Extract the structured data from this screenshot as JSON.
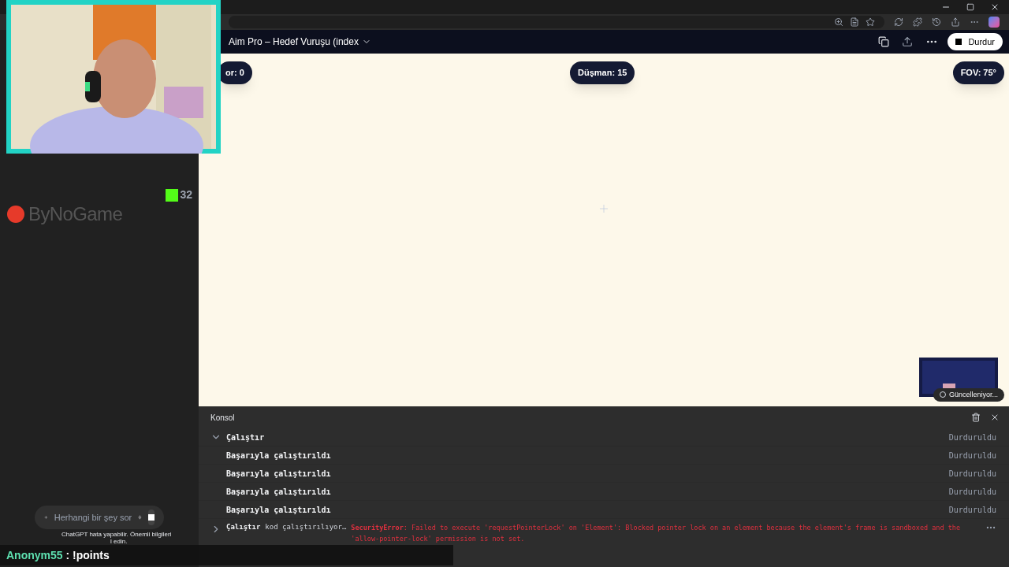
{
  "header": {
    "title": "Aim Pro – Hedef Vuruşu (index",
    "stop_button": "Durdur"
  },
  "hud": {
    "left": "or: 0",
    "center": "Düşman: 15",
    "right": "FOV: 75°"
  },
  "minimap": {
    "status": "Güncelleniyor..."
  },
  "sidebar": {
    "logo": "ByNoGame",
    "viewer_count": "32",
    "input_placeholder": "Herhangi bir şey sor",
    "footnote": "ChatGPT hata yapabilir. Önemli bilgileri",
    "footnote_tail": "l edin."
  },
  "chat_overlay": {
    "user": "Anonym55",
    "message": " : !points"
  },
  "console": {
    "title": "Konsol",
    "rows": [
      {
        "kind": "group",
        "expanded": true,
        "label": "Çalıştır",
        "status": "Durduruldu"
      },
      {
        "kind": "message",
        "label": "Başarıyla çalıştırıldı",
        "status": "Durduruldu"
      },
      {
        "kind": "message",
        "label": "Başarıyla çalıştırıldı",
        "status": "Durduruldu"
      },
      {
        "kind": "message",
        "label": "Başarıyla çalıştırıldı",
        "status": "Durduruldu"
      },
      {
        "kind": "message",
        "label": "Başarıyla çalıştırıldı",
        "status": "Durduruldu"
      },
      {
        "kind": "error",
        "expanded": false,
        "label": "Çalıştır",
        "detail": "kod çalıştırılıyor…",
        "error_name": "SecurityError",
        "error": ": Failed to execute 'requestPointerLock' on 'Element': Blocked pointer lock on an element because the element's frame is sandboxed and the 'allow-pointer-lock' permission is not set."
      }
    ]
  }
}
